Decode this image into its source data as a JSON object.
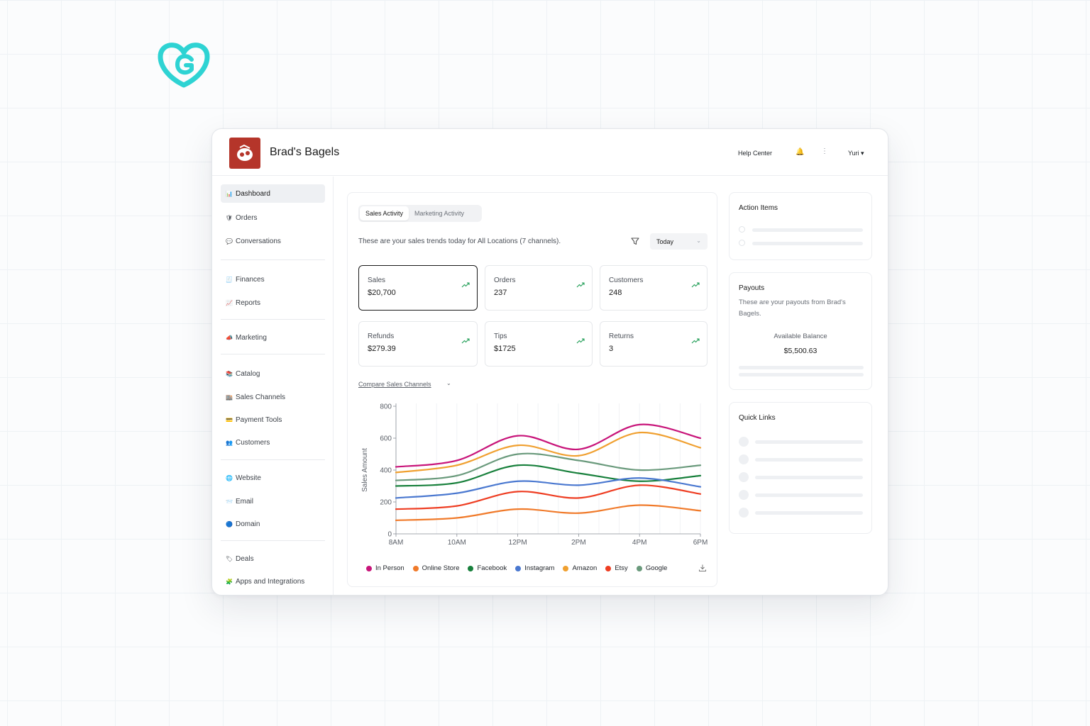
{
  "header": {
    "store_name": "Brad's Bagels",
    "help_center": "Help Center",
    "user": "Yuri ▾"
  },
  "sidebar": {
    "items": [
      {
        "label": "Dashboard",
        "icon": "📊",
        "icon_name": "bar-chart-icon",
        "active": true
      },
      {
        "label": "Orders",
        "icon": "🛡",
        "icon_name": "orders-icon"
      },
      {
        "label": "Conversations",
        "icon": "💬",
        "icon_name": "chat-bubble-icon"
      },
      {
        "label": "Finances",
        "icon": "🧾",
        "icon_name": "finances-icon"
      },
      {
        "label": "Reports",
        "icon": "📈",
        "icon_name": "line-chart-icon"
      },
      {
        "label": "Marketing",
        "icon": "📣",
        "icon_name": "megaphone-icon"
      },
      {
        "label": "Catalog",
        "icon": "📚",
        "icon_name": "catalog-icon"
      },
      {
        "label": "Sales Channels",
        "icon": "🏬",
        "icon_name": "store-icon"
      },
      {
        "label": "Payment Tools",
        "icon": "💳",
        "icon_name": "credit-card-icon"
      },
      {
        "label": "Customers",
        "icon": "👥",
        "icon_name": "people-icon"
      },
      {
        "label": "Website",
        "icon": "🌐",
        "icon_name": "globe-icon"
      },
      {
        "label": "Email",
        "icon": "📨",
        "icon_name": "envelope-icon"
      },
      {
        "label": "Domain",
        "icon": "🔵",
        "icon_name": "domain-icon"
      },
      {
        "label": "Deals",
        "icon": "🏷",
        "icon_name": "tag-icon"
      },
      {
        "label": "Apps and Integrations",
        "icon": "🧩",
        "icon_name": "puzzle-icon"
      }
    ]
  },
  "main": {
    "tabs": [
      "Sales Activity",
      "Marketing Activity"
    ],
    "trend_text": "These are your sales trends today for All Locations (7 channels).",
    "date_filter": "Today",
    "stats": [
      {
        "label": "Sales",
        "value": "$20,700"
      },
      {
        "label": "Orders",
        "value": "237"
      },
      {
        "label": "Customers",
        "value": "248"
      },
      {
        "label": "Refunds",
        "value": "$279.39"
      },
      {
        "label": "Tips",
        "value": "$1725"
      },
      {
        "label": "Returns",
        "value": "3"
      }
    ],
    "compare_link": "Compare Sales Channels"
  },
  "chart_data": {
    "type": "line",
    "ylabel": "Sales Amount",
    "xlabel": "",
    "ylim": [
      0,
      800
    ],
    "yticks": [
      0,
      200,
      400,
      600,
      800
    ],
    "categories": [
      "8AM",
      "10AM",
      "12PM",
      "2PM",
      "4PM",
      "6PM"
    ],
    "grid": true,
    "legend_position": "bottom",
    "series": [
      {
        "name": "In Person",
        "color": "#c8157a",
        "values": [
          420,
          460,
          615,
          530,
          685,
          600
        ]
      },
      {
        "name": "Online Store",
        "color": "#f07a2a",
        "values": [
          85,
          100,
          155,
          130,
          180,
          145
        ]
      },
      {
        "name": "Facebook",
        "color": "#18803c",
        "values": [
          300,
          320,
          430,
          380,
          330,
          365
        ]
      },
      {
        "name": "Instagram",
        "color": "#4a78d0",
        "values": [
          225,
          255,
          330,
          305,
          350,
          295
        ]
      },
      {
        "name": "Amazon",
        "color": "#f0a030",
        "values": [
          385,
          430,
          555,
          490,
          635,
          540
        ]
      },
      {
        "name": "Etsy",
        "color": "#ee3d22",
        "values": [
          155,
          175,
          265,
          225,
          305,
          250
        ]
      },
      {
        "name": "Google",
        "color": "#6a9a7c",
        "values": [
          335,
          365,
          500,
          460,
          400,
          430
        ]
      }
    ]
  },
  "action_items": {
    "title": "Action Items"
  },
  "payouts": {
    "title": "Payouts",
    "description": "These are your payouts from Brad's Bagels.",
    "balance_label": "Available Balance",
    "balance_value": "$5,500.63"
  },
  "quick_links": {
    "title": "Quick Links"
  },
  "colors": {
    "brand": "#2ed3d3",
    "store_logo": "#b5352a",
    "trend_up": "#1f9d55"
  }
}
